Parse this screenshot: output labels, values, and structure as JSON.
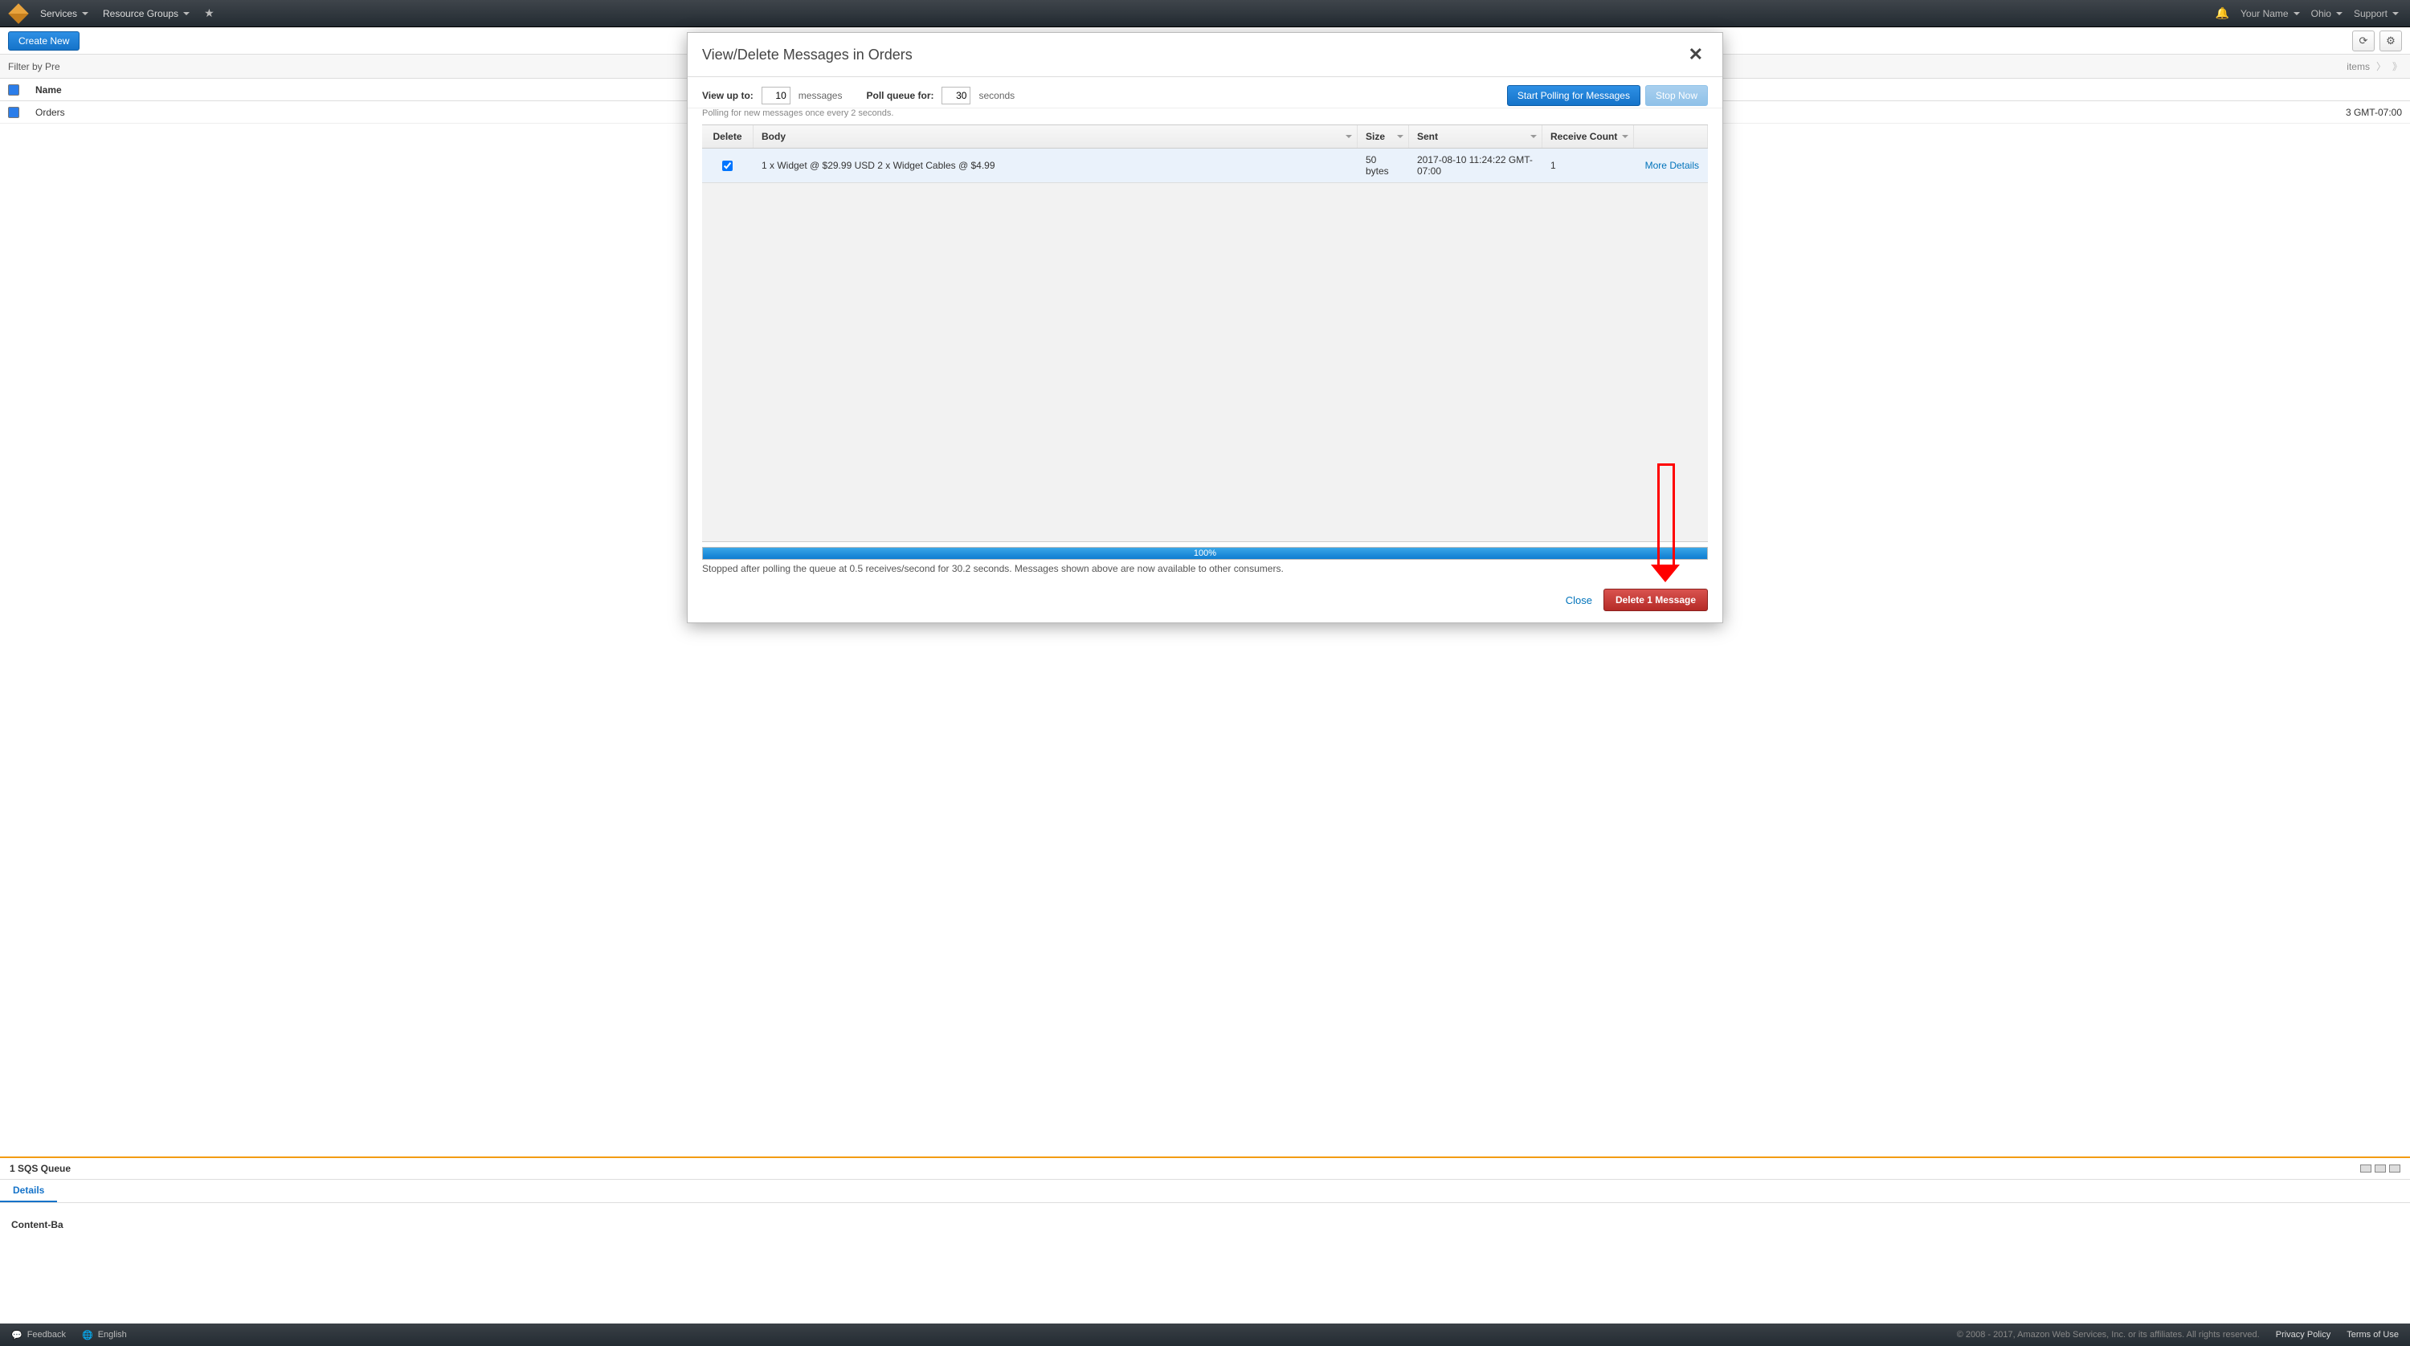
{
  "topnav": {
    "services": "Services",
    "resource_groups": "Resource Groups",
    "your_name": "Your Name",
    "region": "Ohio",
    "support": "Support"
  },
  "page": {
    "create_button": "Create New",
    "filter_label": "Filter by Pre",
    "items_label": "items",
    "head_name": "Name",
    "row_name": "Orders",
    "row_date": "3 GMT-07:00",
    "selected_label": "1 SQS Queue",
    "details_tab": "Details",
    "content_label": "Content-Ba"
  },
  "modal": {
    "title": "View/Delete Messages in Orders",
    "view_up_to_label": "View up to:",
    "view_up_to_value": "10",
    "messages_unit": "messages",
    "poll_for_label": "Poll queue for:",
    "poll_for_value": "30",
    "seconds_unit": "seconds",
    "start_polling_btn": "Start Polling for Messages",
    "stop_now_btn": "Stop Now",
    "polling_subtext": "Polling for new messages once every 2 seconds.",
    "columns": {
      "delete": "Delete",
      "body": "Body",
      "size": "Size",
      "sent": "Sent",
      "receive_count": "Receive Count"
    },
    "rows": [
      {
        "checked": true,
        "body": "1 x Widget @ $29.99 USD 2 x Widget Cables @ $4.99",
        "size": "50 bytes",
        "sent": "2017-08-10 11:24:22 GMT-07:00",
        "receive_count": "1",
        "more": "More Details"
      }
    ],
    "progress_pct": "100%",
    "status_text": "Stopped after polling the queue at 0.5 receives/second for 30.2 seconds. Messages shown above are now available to other consumers.",
    "close_btn": "Close",
    "delete_btn": "Delete 1 Message"
  },
  "footer": {
    "feedback": "Feedback",
    "english": "English",
    "copyright": "© 2008 - 2017, Amazon Web Services, Inc. or its affiliates. All rights reserved.",
    "privacy": "Privacy Policy",
    "terms": "Terms of Use"
  }
}
